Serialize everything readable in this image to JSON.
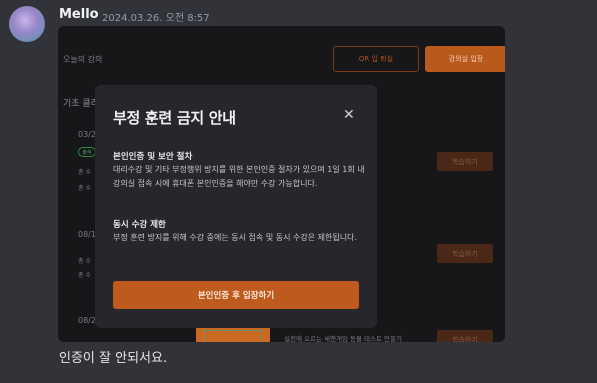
{
  "author": {
    "name": "Mello",
    "timestamp": "2024.03.26. 오전 8:57"
  },
  "message": {
    "text": "인증이 잘 안되서요."
  },
  "screenshot": {
    "header": {
      "label": "오늘의 강의",
      "qr_button": "QR 입 퇴실",
      "enter_button": "강의실 입장"
    },
    "section_label": "기초 클라",
    "rows": [
      {
        "date": "03/2",
        "badge": "출석",
        "line1": "총 수",
        "line2": "총 수",
        "action": "학습하기"
      },
      {
        "date": "08/1",
        "line1": "총 수",
        "line2": "총 수",
        "action": "학습하기"
      },
      {
        "date": "08/2",
        "caption": "실전에 오르는 세맨게임 동물 테스트 만들기",
        "action": "학습하기"
      }
    ],
    "modal": {
      "title": "부정 훈련 금지 안내",
      "close": "✕",
      "sections": [
        {
          "heading": "본인인증 및 보안 절차",
          "body": "대리수강 및 기타 부정행위 방지를 위한 본인인증 절차가 있으며 1일 1회 내 강의실 접속 시에 휴대폰 본인인증을 해야만 수강 가능합니다."
        },
        {
          "heading": "동시 수강 제한",
          "body": "부정 훈련 방지를 위해 수강 중에는 동시 접속 및 동시 수강은 제한됩니다."
        }
      ],
      "confirm_button": "본인인증 후 입장하기"
    }
  },
  "colors": {
    "background": "#313338",
    "accent": "#bf5a1e",
    "modal": "#27272b"
  }
}
